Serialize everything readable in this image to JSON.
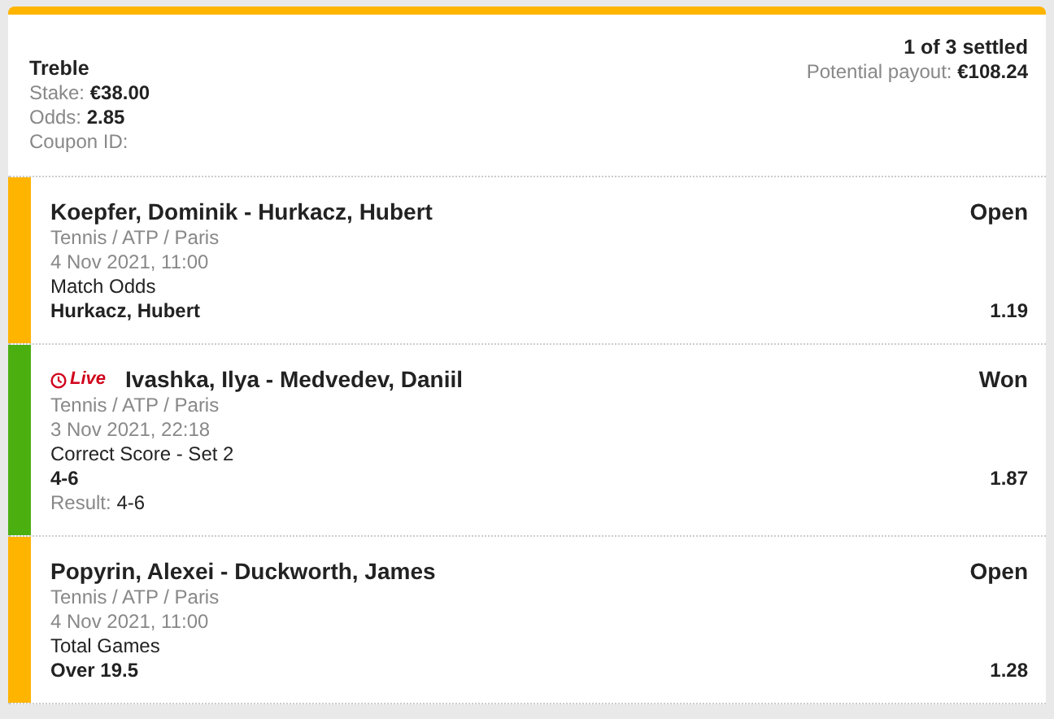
{
  "coupon": {
    "type": "Treble",
    "details": [
      {
        "label": "Stake:",
        "value": "€38.00"
      },
      {
        "label": "Odds:",
        "value": "2.85"
      },
      {
        "label": "Coupon ID:"
      }
    ],
    "settled": "1 of 3 settled",
    "payout_label": "Potential payout:",
    "payout": "€108.24"
  },
  "legs": [
    {
      "status": "Open",
      "color": "#ffb400",
      "event": "Koepfer, Dominik - Hurkacz, Hubert",
      "category": "Tennis / ATP / Paris",
      "date": "4 Nov 2021, 11:00",
      "market": "Match Odds",
      "selection": "Hurkacz, Hubert",
      "odds": "1.19"
    },
    {
      "status": "Won",
      "color": "#4caf10",
      "live": "Live",
      "event": "Ivashka, Ilya - Medvedev, Daniil",
      "category": "Tennis / ATP / Paris",
      "date": "3 Nov 2021, 22:18",
      "market": "Correct Score - Set 2",
      "selection": "4-6",
      "odds": "1.87",
      "result_label": "Result:",
      "result": "4-6"
    },
    {
      "status": "Open",
      "color": "#ffb400",
      "event": "Popyrin, Alexei - Duckworth, James",
      "category": "Tennis / ATP / Paris",
      "date": "4 Nov 2021, 11:00",
      "market": "Total Games",
      "selection": "Over 19.5",
      "odds": "1.28"
    }
  ]
}
